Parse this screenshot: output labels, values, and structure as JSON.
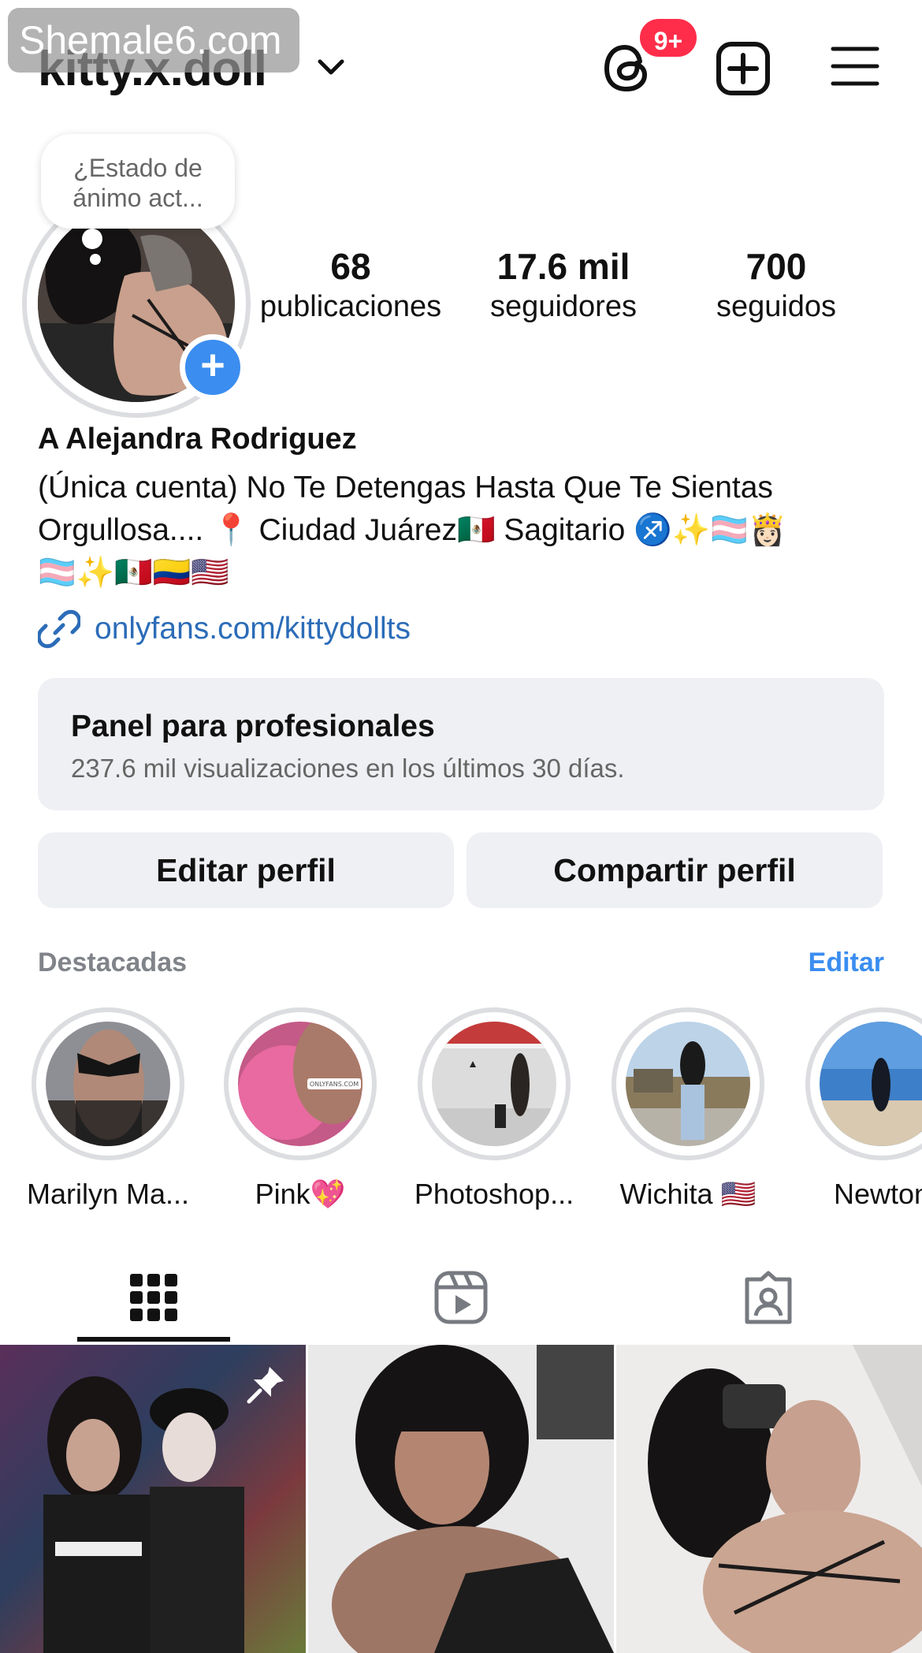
{
  "watermark": "Shemale6.com",
  "header": {
    "username": "kitty.x.doll",
    "notification_badge": "9+"
  },
  "profile": {
    "note": "¿Estado de ánimo act...",
    "stats": [
      {
        "value": "68",
        "label": "publicaciones"
      },
      {
        "value": "17.6 mil",
        "label": "seguidores"
      },
      {
        "value": "700",
        "label": "seguidos"
      }
    ],
    "full_name": "A Alejandra Rodriguez",
    "bio_line1": "(Única cuenta) No Te Detengas Hasta Que Te Sientas",
    "bio_line2": "Orgullosa.... 📍 Ciudad Juárez🇲🇽 Sagitario ♐️✨🏳️‍⚧️👸🏻",
    "bio_line3": "🏳️‍⚧️✨🇲🇽🇨🇴🇺🇸",
    "link": "onlyfans.com/kittydollts"
  },
  "pro_panel": {
    "title": "Panel para profesionales",
    "subtitle": "237.6 mil visualizaciones en los últimos 30 días."
  },
  "buttons": {
    "edit": "Editar perfil",
    "share": "Compartir perfil"
  },
  "highlights": {
    "title": "Destacadas",
    "edit": "Editar",
    "items": [
      {
        "label": "Marilyn Ma...",
        "image_overlay": ""
      },
      {
        "label": "Pink💖",
        "image_overlay": "ONLYFANS.COM"
      },
      {
        "label": "Photoshop...",
        "image_overlay": ""
      },
      {
        "label": "Wichita 🇺🇸",
        "image_overlay": ""
      },
      {
        "label": "Newton",
        "image_overlay": ""
      }
    ]
  },
  "tabs": [
    "grid-icon",
    "reels-icon",
    "tagged-icon"
  ],
  "colors": {
    "accent": "#3b8df0",
    "link": "#2c6cb8",
    "badge": "#ff2d4a",
    "panel_bg": "#eff0f3",
    "muted": "#808389"
  }
}
